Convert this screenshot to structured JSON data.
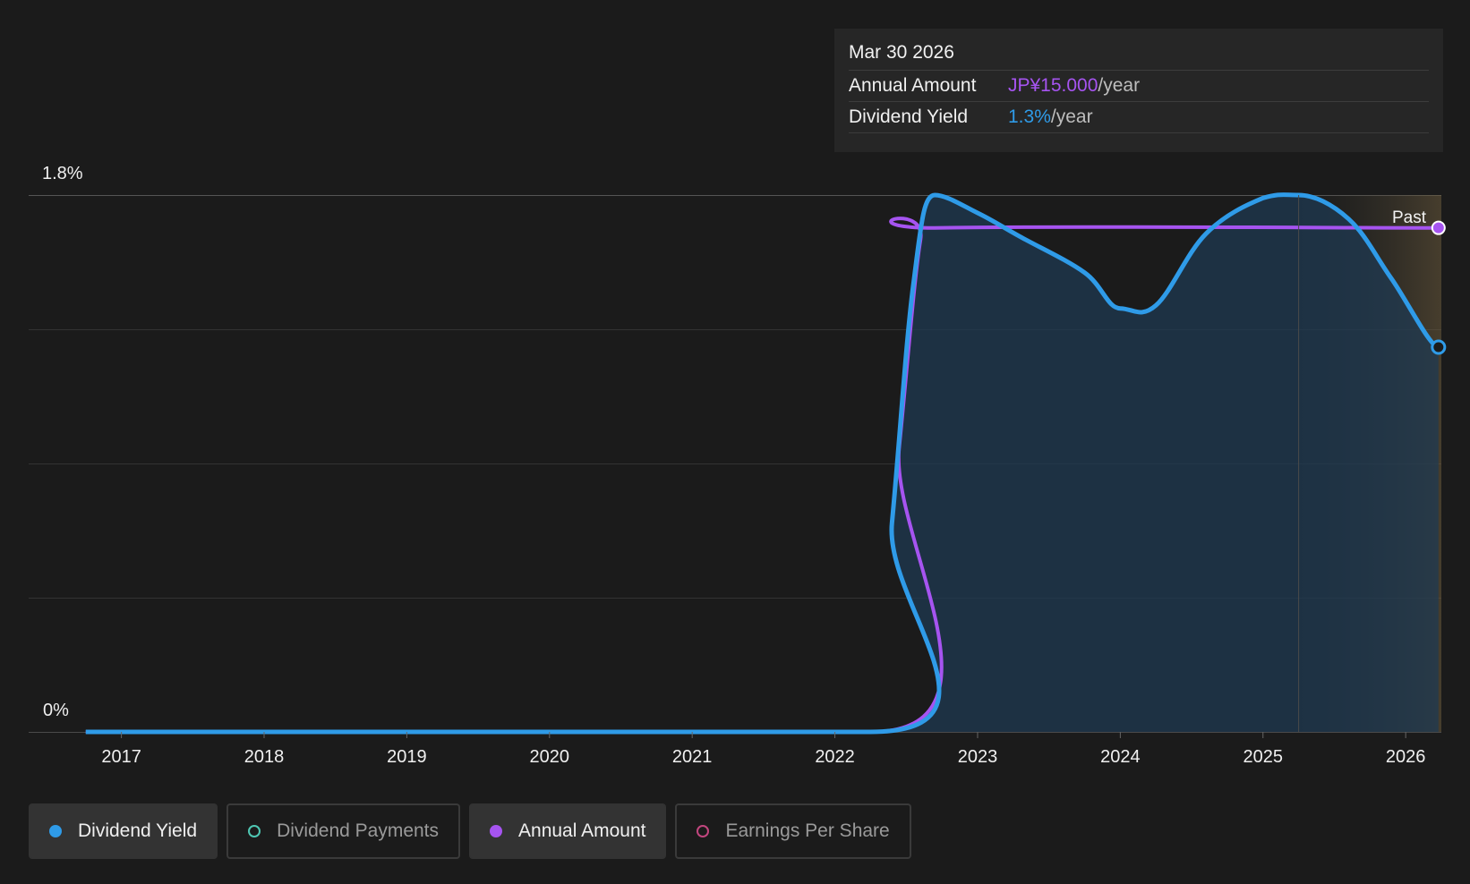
{
  "tooltip": {
    "date": "Mar 30 2026",
    "rows": [
      {
        "label": "Annual Amount",
        "value": "JP¥15.000",
        "unit": "/year"
      },
      {
        "label": "Dividend Yield",
        "value": "1.3%",
        "unit": "/year"
      }
    ]
  },
  "legend": [
    {
      "label": "Dividend Yield",
      "active": true,
      "color": "#2f9be8"
    },
    {
      "label": "Dividend Payments",
      "active": false,
      "color": "#4fc7b3"
    },
    {
      "label": "Annual Amount",
      "active": true,
      "color": "#a654f0"
    },
    {
      "label": "Earnings Per Share",
      "active": false,
      "color": "#c2467e"
    }
  ],
  "chart_data": {
    "type": "area",
    "x_ticks": [
      "2017",
      "2018",
      "2019",
      "2020",
      "2021",
      "2022",
      "2023",
      "2024",
      "2025",
      "2026"
    ],
    "y_ticks": [
      "1.8%",
      "0%"
    ],
    "ylim": [
      0,
      1.8
    ],
    "xlim": [
      2016.35,
      2026.25
    ],
    "past_label": "Past",
    "forecast_start": 2025.25,
    "grid": true,
    "series": [
      {
        "name": "Dividend Yield",
        "color": "#2f9be8",
        "unit": "%",
        "points": [
          [
            2016.75,
            0
          ],
          [
            2022.25,
            0
          ],
          [
            2022.4,
            0.7
          ],
          [
            2022.55,
            1.5
          ],
          [
            2022.7,
            1.8
          ],
          [
            2023.0,
            1.74
          ],
          [
            2023.3,
            1.66
          ],
          [
            2023.75,
            1.54
          ],
          [
            2024.0,
            1.42
          ],
          [
            2024.25,
            1.43
          ],
          [
            2024.6,
            1.67
          ],
          [
            2025.0,
            1.79
          ],
          [
            2025.25,
            1.8
          ],
          [
            2025.6,
            1.72
          ],
          [
            2025.9,
            1.52
          ],
          [
            2026.23,
            1.29
          ]
        ]
      },
      {
        "name": "Annual Amount",
        "color": "#a654f0",
        "unit": "JP¥",
        "points": [
          [
            2016.75,
            0
          ],
          [
            2022.25,
            0
          ],
          [
            2022.45,
            0.95
          ],
          [
            2022.6,
            1.65
          ],
          [
            2022.7,
            1.69
          ],
          [
            2026.23,
            1.69
          ]
        ]
      }
    ]
  }
}
